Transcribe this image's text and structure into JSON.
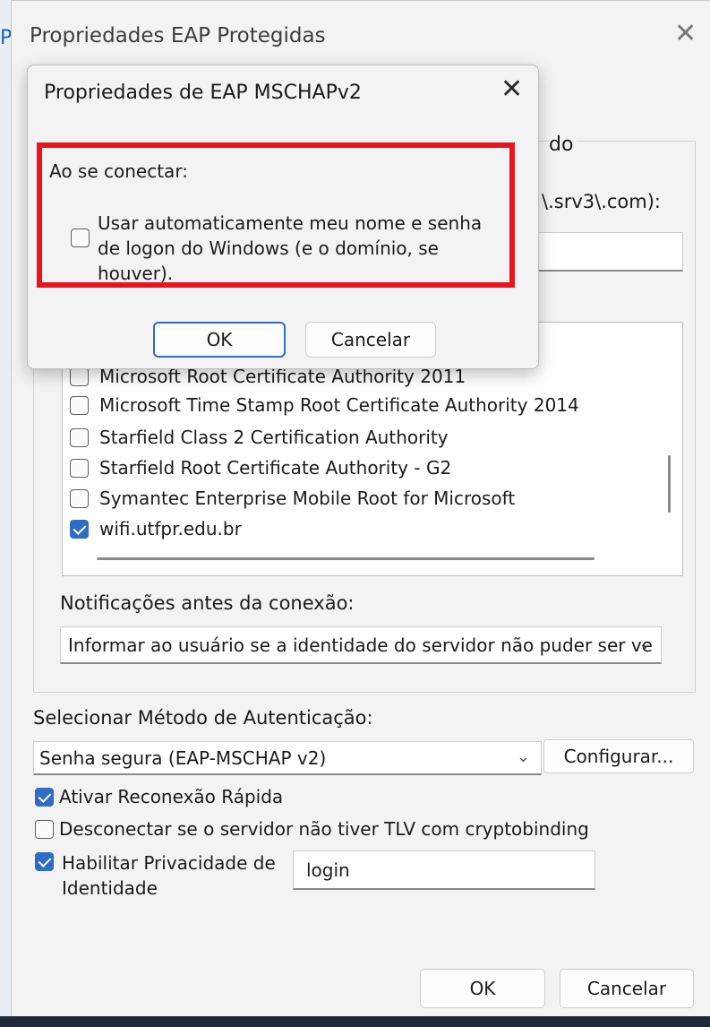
{
  "background": {
    "left_letter": "P"
  },
  "main_window": {
    "title": "Propriedades EAP Protegidas",
    "close_glyph": "✕",
    "group_title_fragment": "do",
    "connect_label_fragment": "\\.srv3\\.com):",
    "certificates": [
      {
        "label": "Microsoft Root Certificate Authority 2011",
        "checked": false
      },
      {
        "label": "Microsoft Time Stamp Root Certificate Authority 2014",
        "checked": false
      },
      {
        "label": "Starfield Class 2 Certification Authority",
        "checked": false
      },
      {
        "label": "Starfield Root Certificate Authority - G2",
        "checked": false
      },
      {
        "label": "Symantec Enterprise Mobile Root for Microsoft",
        "checked": false
      },
      {
        "label": "wifi.utfpr.edu.br",
        "checked": true
      }
    ],
    "notification_label": "Notificações antes da conexão:",
    "notification_value": "Informar ao usuário se a identidade do servidor não puder ser ve",
    "auth_method_label": "Selecionar Método de Autenticação:",
    "auth_method_value": "Senha segura (EAP-MSCHAP v2)",
    "configure_button": "Configurar...",
    "options": [
      {
        "label": "Ativar Reconexão Rápida",
        "checked": true
      },
      {
        "label": "Desconectar se o servidor não tiver TLV com cryptobinding",
        "checked": false
      },
      {
        "label": "Habilitar Privacidade de Identidade",
        "checked": true
      }
    ],
    "identity_value": "login",
    "ok_button": "OK",
    "cancel_button": "Cancelar"
  },
  "dialog": {
    "title": "Propriedades de EAP MSCHAPv2",
    "close_glyph": "✕",
    "connect_label": "Ao se conectar:",
    "auto_logon_text": "Usar automaticamente meu nome e senha de logon do Windows (e o domínio, se houver).",
    "auto_logon_checked": false,
    "ok_button": "OK",
    "cancel_button": "Cancelar",
    "highlight_color": "#e8141e"
  },
  "icons": {
    "chevron": "⌄"
  }
}
